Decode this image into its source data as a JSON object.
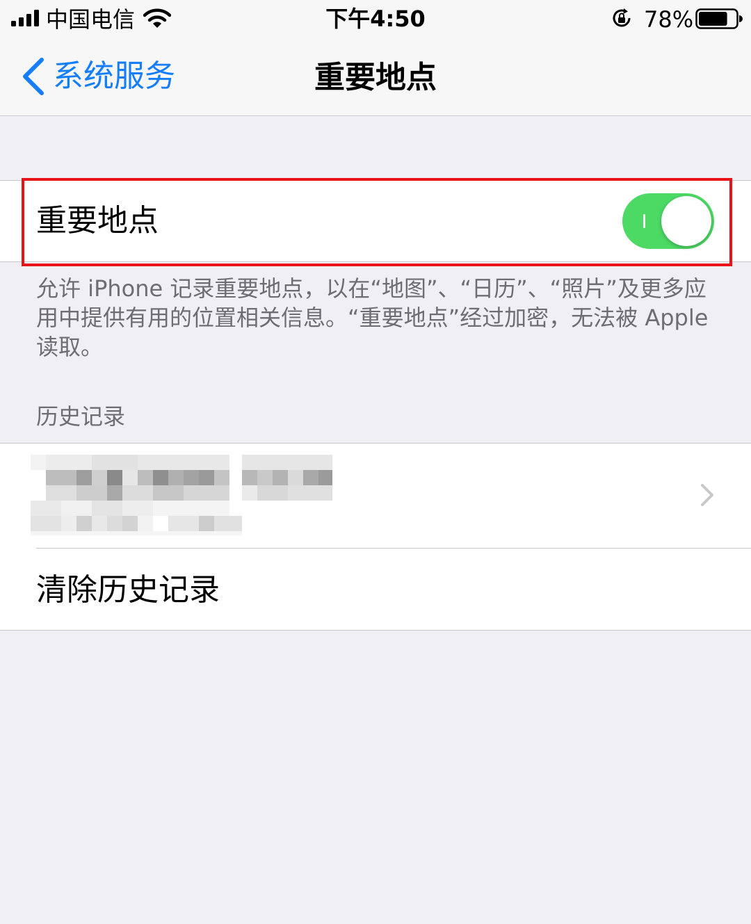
{
  "status_bar": {
    "carrier": "中国电信",
    "time": "下午4:50",
    "battery_percent": "78%",
    "battery_level": 0.78,
    "icons": [
      "signal-icon",
      "wifi-icon",
      "orientation-lock-icon",
      "battery-icon"
    ]
  },
  "nav": {
    "back_label": "系统服务",
    "title": "重要地点",
    "back_icon": "chevron-left-icon"
  },
  "toggle": {
    "label": "重要地点",
    "state": "on",
    "on_color": "#4cd964"
  },
  "footer_note": "允许 iPhone 记录重要地点，以在“地图”、“日历”、“照片”及更多应用中提供有用的位置相关信息。“重要地点”经过加密，无法被 Apple 读取。",
  "history": {
    "header": "历史记录",
    "item_icon": "chevron-right-icon",
    "clear_label": "清除历史记录"
  },
  "colors": {
    "accent_blue": "#147efb",
    "highlight_red": "#e8141a",
    "background": "#efeff4",
    "secondary_text": "#6d6d72"
  }
}
